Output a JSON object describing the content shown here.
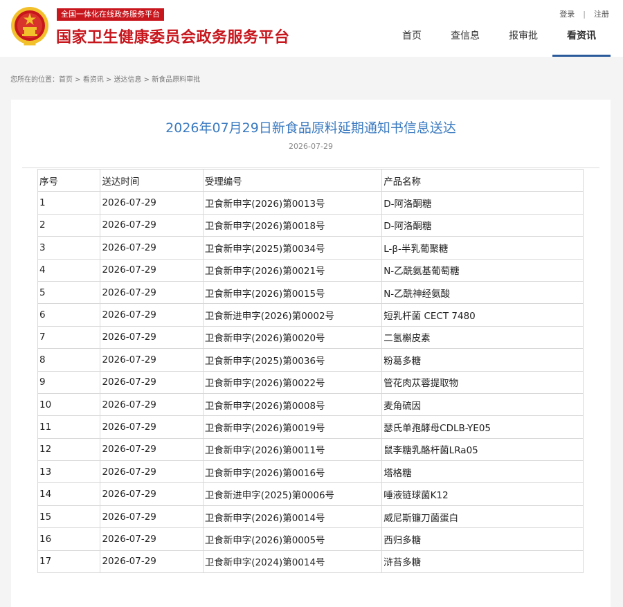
{
  "header": {
    "tagline": "全国一体化在线政务服务平台",
    "site_title": "国家卫生健康委员会政务服务平台",
    "auth": {
      "login": "登录",
      "separator": "|",
      "register": "注册"
    },
    "nav": [
      {
        "label": "首页",
        "active": false
      },
      {
        "label": "查信息",
        "active": false
      },
      {
        "label": "报审批",
        "active": false
      },
      {
        "label": "看资讯",
        "active": true
      }
    ]
  },
  "breadcrumb": {
    "prefix": "您所在的位置：",
    "items": [
      "首页",
      "看资讯",
      "送达信息",
      "新食品原料审批"
    ],
    "separator": " > "
  },
  "article": {
    "title": "2026年07月29日新食品原料延期通知书信息送达",
    "date": "2026-07-29"
  },
  "table": {
    "headers": [
      "序号",
      "送达时间",
      "受理编号",
      "产品名称"
    ],
    "rows": [
      [
        "1",
        "2026-07-29",
        "卫食新申字(2026)第0013号",
        "D-阿洛酮糖"
      ],
      [
        "2",
        "2026-07-29",
        "卫食新申字(2026)第0018号",
        "D-阿洛酮糖"
      ],
      [
        "3",
        "2026-07-29",
        "卫食新申字(2025)第0034号",
        "L-β-半乳葡聚糖"
      ],
      [
        "4",
        "2026-07-29",
        "卫食新申字(2026)第0021号",
        "N-乙酰氨基葡萄糖"
      ],
      [
        "5",
        "2026-07-29",
        "卫食新申字(2026)第0015号",
        "N-乙酰神经氨酸"
      ],
      [
        "6",
        "2026-07-29",
        "卫食新进申字(2026)第0002号",
        "短乳杆菌 CECT 7480"
      ],
      [
        "7",
        "2026-07-29",
        "卫食新申字(2026)第0020号",
        "二氢槲皮素"
      ],
      [
        "8",
        "2026-07-29",
        "卫食新申字(2025)第0036号",
        "粉葛多糖"
      ],
      [
        "9",
        "2026-07-29",
        "卫食新申字(2026)第0022号",
        "管花肉苁蓉提取物"
      ],
      [
        "10",
        "2026-07-29",
        "卫食新申字(2026)第0008号",
        "麦角硫因"
      ],
      [
        "11",
        "2026-07-29",
        "卫食新申字(2026)第0019号",
        "瑟氏单孢酵母CDLB-YE05"
      ],
      [
        "12",
        "2026-07-29",
        "卫食新申字(2026)第0011号",
        "鼠李糖乳酪杆菌LRa05"
      ],
      [
        "13",
        "2026-07-29",
        "卫食新申字(2026)第0016号",
        "塔格糖"
      ],
      [
        "14",
        "2026-07-29",
        "卫食新进申字(2025)第0006号",
        "唾液链球菌K12"
      ],
      [
        "15",
        "2026-07-29",
        "卫食新申字(2026)第0014号",
        "威尼斯镰刀菌蛋白"
      ],
      [
        "16",
        "2026-07-29",
        "卫食新申字(2026)第0005号",
        "西归多糖"
      ],
      [
        "17",
        "2026-07-29",
        "卫食新申字(2024)第0014号",
        "浒苔多糖"
      ]
    ]
  },
  "colors": {
    "brand_red": "#c8161d",
    "title_blue": "#3a7ac0",
    "nav_underline": "#2a5a9a",
    "emblem_gold": "#f2c02b"
  },
  "icons": {
    "emblem": "national-emblem-icon"
  }
}
